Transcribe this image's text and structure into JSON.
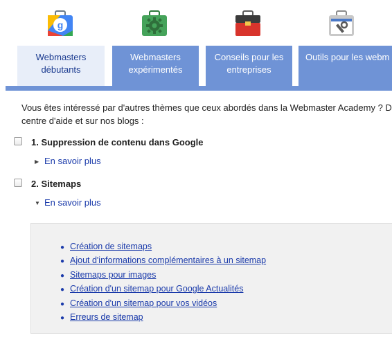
{
  "tabs": [
    {
      "icon": "google-badge-icon",
      "color": "#e8eef9",
      "line1": "Webmasters",
      "line2": "débutants"
    },
    {
      "icon": "gear-briefcase-icon",
      "color": "#6f93d6",
      "line1": "Webmasters",
      "line2": "expérimentés"
    },
    {
      "icon": "red-toolbox-icon",
      "color": "#6f93d6",
      "line1": "Conseils pour les",
      "line2": "entreprises"
    },
    {
      "icon": "browser-wrench-icon",
      "color": "#6f93d6",
      "line1": "Outils pour les webm",
      "line2": ""
    }
  ],
  "intro": {
    "line1": "Vous êtes intéressé par d'autres thèmes que ceux abordés dans la Webmaster Academy ? De",
    "line2": "centre d'aide et sur nos blogs :"
  },
  "items": [
    {
      "title": "1. Suppression de contenu dans Google",
      "more_label": "En savoir plus",
      "expanded": false
    },
    {
      "title": "2. Sitemaps",
      "more_label": "En savoir plus",
      "expanded": true
    }
  ],
  "links": [
    "Création de sitemaps",
    "Ajout d'informations complémentaires à un sitemap",
    "Sitemaps pour images",
    "Création d'un sitemap pour Google Actualités",
    "Création d'un sitemap pour vos vidéos",
    "Erreurs de sitemap"
  ],
  "colors": {
    "tab_active_bg": "#e8eef9",
    "tab_inactive_bg": "#6f93d6",
    "link": "#1a3aaa",
    "panel_bg": "#f1f1f1"
  }
}
